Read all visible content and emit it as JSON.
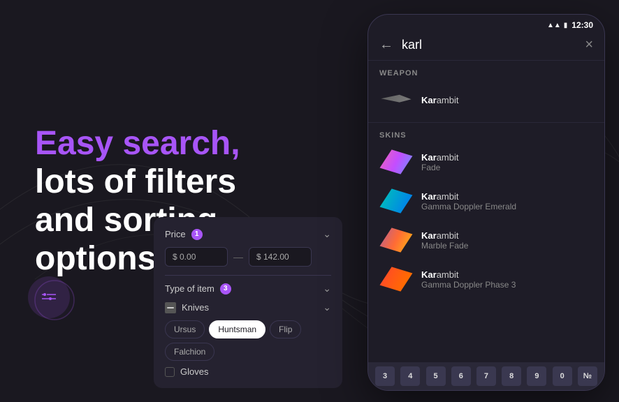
{
  "headline": {
    "line1_highlight": "Easy search,",
    "line2": "lots of filters",
    "line3": "and sorting",
    "line4": "options"
  },
  "filter": {
    "price_label": "Price",
    "price_badge": "1",
    "price_min": "$ 0.00",
    "price_max": "$ 142.00",
    "type_label": "Type of item",
    "type_badge": "3",
    "knives_label": "Knives",
    "tags": [
      "Ursus",
      "Huntsman",
      "Flip",
      "Falchion"
    ],
    "active_tag": "Huntsman",
    "gloves_label": "Gloves"
  },
  "phone": {
    "status_time": "12:30",
    "search_value": "karl",
    "search_placeholder": "karl",
    "clear_label": "×",
    "sections": [
      {
        "title": "WEAPON",
        "items": [
          {
            "name_highlight": "Kar",
            "name_rest": "ambit",
            "sub": "",
            "img_class": "knife-img-weapon"
          }
        ]
      },
      {
        "title": "SKINS",
        "items": [
          {
            "name_highlight": "Kar",
            "name_rest": "ambit",
            "sub": "Fade",
            "img_class": "knife-img-fade"
          },
          {
            "name_highlight": "Kar",
            "name_rest": "ambit",
            "sub": "Gamma Doppler Emerald",
            "img_class": "knife-img-green"
          },
          {
            "name_highlight": "Kar",
            "name_rest": "ambit",
            "sub": "Marble Fade",
            "img_class": "knife-img-marble"
          },
          {
            "name_highlight": "Kar",
            "name_rest": "ambit",
            "sub": "Gamma Doppler Phase 3",
            "img_class": "knife-img-red"
          }
        ]
      }
    ],
    "keyboard_keys": [
      "3",
      "4",
      "5",
      "6",
      "7",
      "8",
      "9",
      "0",
      "№"
    ]
  },
  "icons": {
    "back": "←",
    "close": "✕",
    "filter_icon": "≡",
    "chevron_down": "⌄",
    "wifi": "▲",
    "battery": "▮"
  }
}
